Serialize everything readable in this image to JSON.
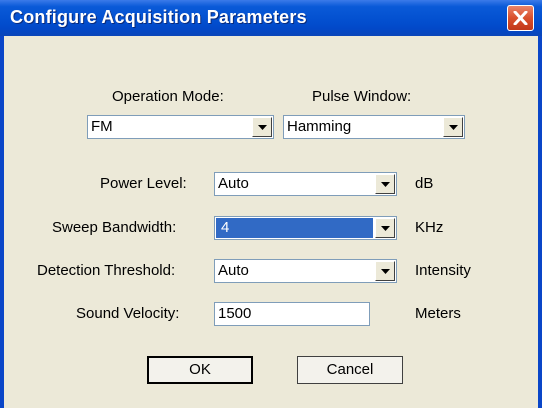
{
  "window": {
    "title": "Configure Acquisition Parameters"
  },
  "operation_mode": {
    "label": "Operation Mode:",
    "value": "FM"
  },
  "pulse_window": {
    "label": "Pulse Window:",
    "value": "Hamming"
  },
  "power_level": {
    "label": "Power Level:",
    "value": "Auto",
    "unit": "dB"
  },
  "sweep_bandwidth": {
    "label": "Sweep Bandwidth:",
    "value": "4",
    "unit": "KHz"
  },
  "detection_threshold": {
    "label": "Detection Threshold:",
    "value": "Auto",
    "unit": "Intensity"
  },
  "sound_velocity": {
    "label": "Sound Velocity:",
    "value": "1500",
    "unit": "Meters"
  },
  "buttons": {
    "ok": "OK",
    "cancel": "Cancel"
  },
  "icons": {
    "close": "close-icon",
    "dropdown": "chevron-down-icon"
  },
  "colors": {
    "title_bar": "#0350d0",
    "close_button": "#d9502d",
    "selection": "#316ac5",
    "dialog_bg": "#ece9d8"
  }
}
